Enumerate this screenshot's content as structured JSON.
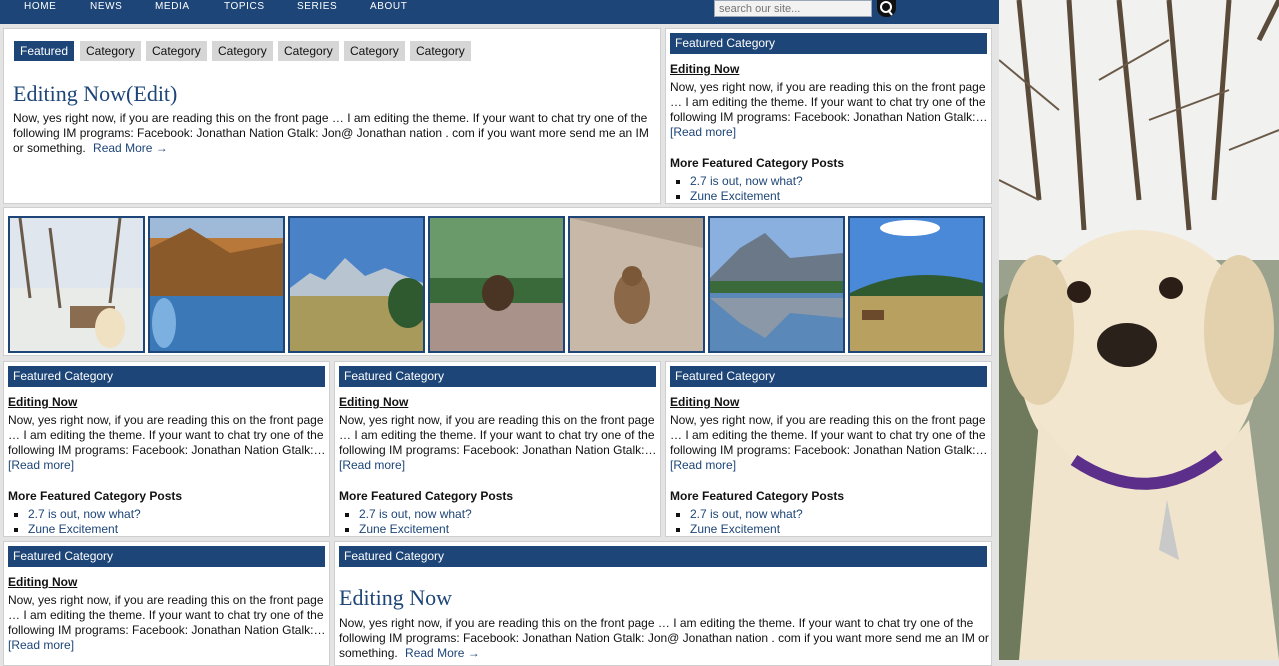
{
  "nav": {
    "items": [
      "HOME",
      "NEWS",
      "MEDIA",
      "TOPICS",
      "SERIES",
      "ABOUT"
    ],
    "search_placeholder": "search our site..."
  },
  "tabs": [
    "Featured",
    "Category",
    "Category",
    "Category",
    "Category",
    "Category",
    "Category"
  ],
  "featured_post": {
    "title": "Editing Now(Edit)",
    "excerpt": "Now, yes right now, if you are reading this on the front page … I am editing the theme. If  your want to chat try one of the following IM programs: Facebook: Jonathan Nation Gtalk: Jon@ Jonathan nation . com if you want more send me an IM or something.",
    "read_more": "Read More →"
  },
  "category_box": {
    "header": "Featured Category",
    "post_title": "Editing Now",
    "excerpt": "Now, yes right now, if you are reading this on the front page … I am editing the theme. If  your want to chat try one of the following IM programs: Facebook: Jonathan Nation Gtalk:…",
    "read_more": "[Read more]",
    "more_heading": "More Featured Category Posts",
    "more_posts": [
      "2.7 is out, now what?",
      "Zune Excitement"
    ]
  },
  "wide_box": {
    "header": "Featured Category",
    "title": "Editing Now",
    "excerpt": "Now, yes right now, if you are reading this on the front page … I am editing the theme. If  your want to chat try one of the following IM programs: Facebook: Jonathan Nation Gtalk: Jon@ Jonathan nation . com if you want more send me an IM or something.",
    "read_more": "Read More →"
  },
  "colors": {
    "nav_bg": "#1d4577",
    "link": "#1d4577",
    "tab_inactive": "#d6d6d6",
    "page_bg": "#e4e4e4"
  },
  "gallery": [
    "snowy-yard-dog-photo",
    "autumn-pond-photo",
    "mountain-meadow-photo",
    "marmot-on-rock-photo",
    "chipmunk-on-rock-photo",
    "mountain-lake-reflection-photo",
    "elk-in-field-photo"
  ]
}
